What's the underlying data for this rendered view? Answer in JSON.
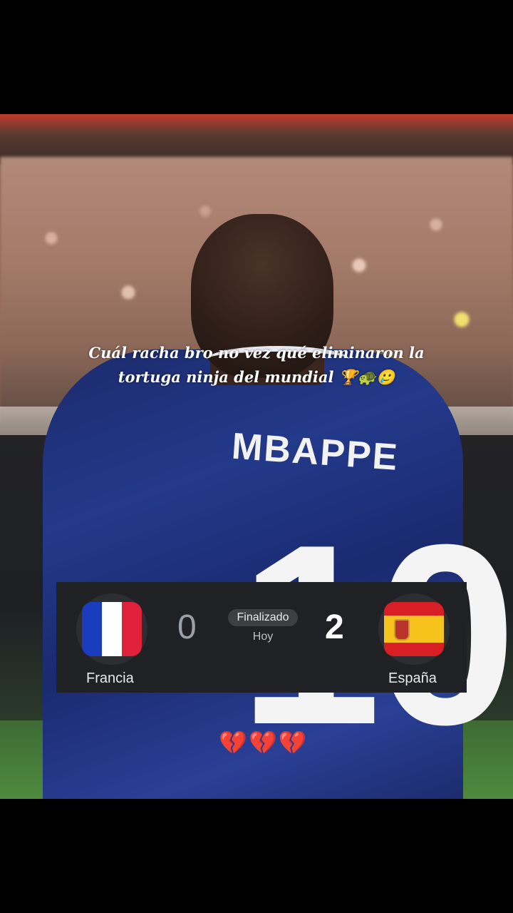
{
  "caption": {
    "line1": "Cuál racha bro no vez qué eliminaron la",
    "line2": "tortuga ninja del mundial 🏆🐢🥲"
  },
  "jersey": {
    "name": "MBAPPE",
    "number": "10"
  },
  "match": {
    "home_team": "Francia",
    "away_team": "España",
    "home_score": "0",
    "away_score": "2",
    "status": "Finalizado",
    "date": "Hoy"
  },
  "overlay_emojis": "💔💔💔",
  "colors": {
    "card_bg": "#202124",
    "jersey_blue": "#23398a",
    "france_blue": "#1a3dbf",
    "france_red": "#e1203a",
    "spain_red": "#d91f26",
    "spain_yellow": "#f6c21c"
  }
}
